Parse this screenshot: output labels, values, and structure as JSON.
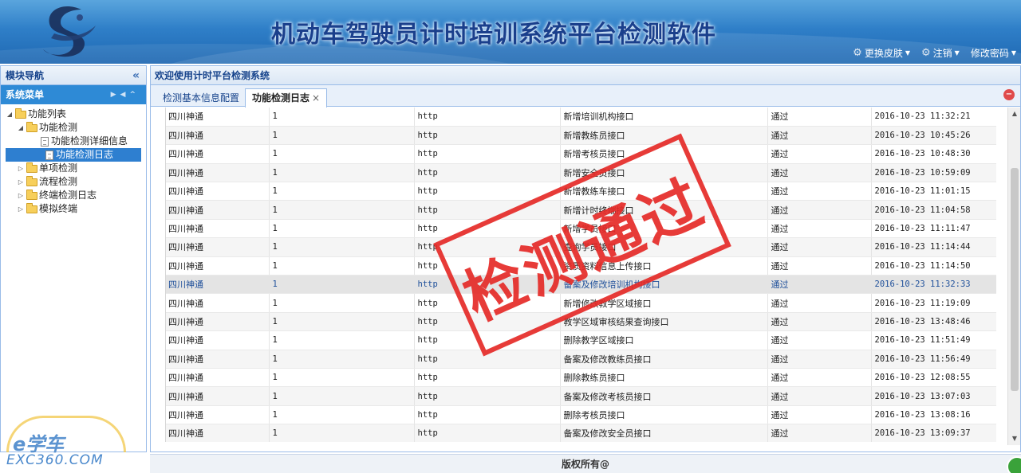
{
  "header": {
    "title": "机动车驾驶员计时培训系统平台检测软件",
    "links": [
      {
        "label": "更换皮肤",
        "icon": "gear-icon"
      },
      {
        "label": "注销",
        "icon": "gear-icon"
      },
      {
        "label": "修改密码",
        "icon": ""
      }
    ]
  },
  "left": {
    "title": "模块导航",
    "menu_title": "系统菜单",
    "tree": [
      {
        "label": "功能列表",
        "icon": "folder",
        "level": 0,
        "expanded": true
      },
      {
        "label": "功能检测",
        "icon": "folder",
        "level": 1,
        "expanded": true
      },
      {
        "label": "功能检测详细信息",
        "icon": "file",
        "level": 2
      },
      {
        "label": "功能检测日志",
        "icon": "file",
        "level": 2,
        "selected": true
      },
      {
        "label": "单项检测",
        "icon": "folder",
        "level": 1,
        "expanded": false
      },
      {
        "label": "流程检测",
        "icon": "folder",
        "level": 1,
        "expanded": false
      },
      {
        "label": "终端检测日志",
        "icon": "folder",
        "level": 1,
        "expanded": false
      },
      {
        "label": "模拟终端",
        "icon": "folder",
        "level": 1,
        "expanded": false
      }
    ]
  },
  "watermark": {
    "brand": "e学车",
    "url": "EXC360.COM"
  },
  "main": {
    "welcome": "欢迎使用计时平台检测系统",
    "tabs": [
      {
        "label": "检测基本信息配置",
        "active": false
      },
      {
        "label": "功能检测日志",
        "active": true,
        "close": "×"
      }
    ],
    "rows": [
      [
        "四川神通",
        "1",
        "http",
        "新增培训机构接口",
        "通过",
        "2016-10-23 11:32:21"
      ],
      [
        "四川神通",
        "1",
        "http",
        "新增教练员接口",
        "通过",
        "2016-10-23 10:45:26"
      ],
      [
        "四川神通",
        "1",
        "http",
        "新增考核员接口",
        "通过",
        "2016-10-23 10:48:30"
      ],
      [
        "四川神通",
        "1",
        "http",
        "新增安全员接口",
        "通过",
        "2016-10-23 10:59:09"
      ],
      [
        "四川神通",
        "1",
        "http",
        "新增教练车接口",
        "通过",
        "2016-10-23 11:01:15"
      ],
      [
        "四川神通",
        "1",
        "http",
        "新增计时终端接口",
        "通过",
        "2016-10-23 11:04:58"
      ],
      [
        "四川神通",
        "1",
        "http",
        "新增学员接口",
        "通过",
        "2016-10-23 11:11:47"
      ],
      [
        "四川神通",
        "1",
        "http",
        "查询学员接口",
        "通过",
        "2016-10-23 11:14:44"
      ],
      [
        "四川神通",
        "1",
        "http",
        "资质资料信息上传接口",
        "通过",
        "2016-10-23 11:14:50"
      ],
      [
        "四川神通",
        "1",
        "http",
        "备案及修改培训机构接口",
        "通过",
        "2016-10-23 11:32:33"
      ],
      [
        "四川神通",
        "1",
        "http",
        "新增修改教学区域接口",
        "通过",
        "2016-10-23 11:19:09"
      ],
      [
        "四川神通",
        "1",
        "http",
        "教学区域审核结果查询接口",
        "通过",
        "2016-10-23 13:48:46"
      ],
      [
        "四川神通",
        "1",
        "http",
        "删除教学区域接口",
        "通过",
        "2016-10-23 11:51:49"
      ],
      [
        "四川神通",
        "1",
        "http",
        "备案及修改教练员接口",
        "通过",
        "2016-10-23 11:56:49"
      ],
      [
        "四川神通",
        "1",
        "http",
        "删除教练员接口",
        "通过",
        "2016-10-23 12:08:55"
      ],
      [
        "四川神通",
        "1",
        "http",
        "备案及修改考核员接口",
        "通过",
        "2016-10-23 13:07:03"
      ],
      [
        "四川神通",
        "1",
        "http",
        "删除考核员接口",
        "通过",
        "2016-10-23 13:08:16"
      ],
      [
        "四川神通",
        "1",
        "http",
        "备案及修改安全员接口",
        "通过",
        "2016-10-23 13:09:37"
      ]
    ],
    "highlight_row": 9,
    "stamp": "检测通过"
  },
  "footer": {
    "text": "版权所有@"
  },
  "colors": {
    "accent": "#2e8ad6",
    "stamp": "#e52b28",
    "header": "#2f7fc8"
  }
}
